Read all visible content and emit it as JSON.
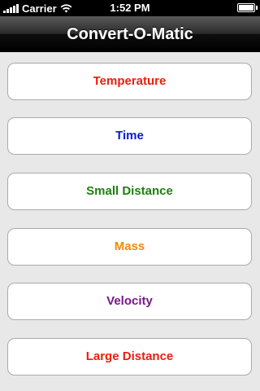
{
  "status_bar": {
    "carrier": "Carrier",
    "time": "1:52 PM",
    "battery_level": 1.0
  },
  "nav": {
    "title": "Convert-O-Matic"
  },
  "menu": {
    "items": [
      {
        "label": "Temperature",
        "color": "#e8200c"
      },
      {
        "label": "Time",
        "color": "#0a1ad6"
      },
      {
        "label": "Small Distance",
        "color": "#1e8010"
      },
      {
        "label": "Mass",
        "color": "#f08a10"
      },
      {
        "label": "Velocity",
        "color": "#7a168a"
      },
      {
        "label": "Large Distance",
        "color": "#e8200c"
      }
    ]
  }
}
